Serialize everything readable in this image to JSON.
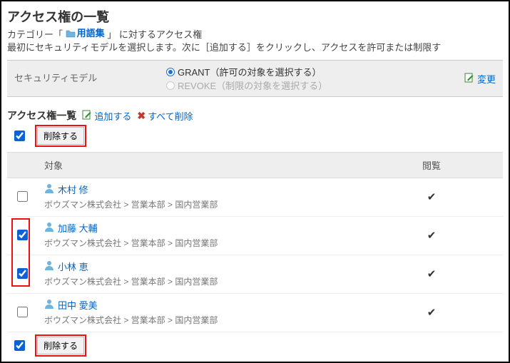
{
  "title": "アクセス権の一覧",
  "subhead_prefix": "カテゴリー「",
  "subhead_category": "用語集",
  "subhead_suffix": "」 に対するアクセス権",
  "subhead_line2": "最初にセキュリティモデルを選択します。次に［追加する］をクリックし、アクセスを許可または制限す",
  "secmodel": {
    "label": "セキュリティモデル",
    "grant": "GRANT（許可の対象を選択する）",
    "revoke": "REVOKE（制限の対象を選択する）",
    "change": "変更"
  },
  "section": {
    "title": "アクセス権一覧",
    "add": "追加する",
    "delete_all": "すべて削除"
  },
  "toolbar": {
    "delete": "削除する"
  },
  "table": {
    "col_target": "対象",
    "col_view": "閲覧"
  },
  "rows": [
    {
      "name": "木村 修",
      "path": "ボウズマン株式会社 > 営業本部 > 国内営業部",
      "checked": false
    },
    {
      "name": "加藤 大輔",
      "path": "ボウズマン株式会社 > 営業本部 > 国内営業部",
      "checked": true
    },
    {
      "name": "小林 恵",
      "path": "ボウズマン株式会社 > 営業本部 > 国内営業部",
      "checked": true
    },
    {
      "name": "田中 愛美",
      "path": "ボウズマン株式会社 > 営業本部 > 国内営業部",
      "checked": false
    }
  ]
}
